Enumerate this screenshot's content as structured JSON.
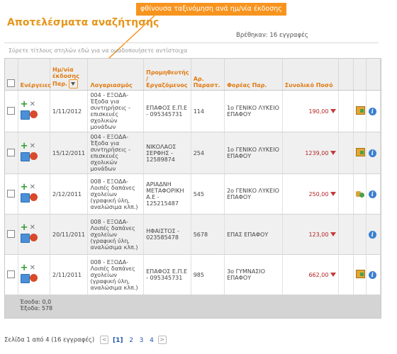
{
  "callout": "φθίνουσα ταξινόμηση ανά ημ/νία έκδοσης",
  "title": "Αποτελέσματα αναζήτησης",
  "found": "Βρέθηκαν: 16 εγγραφές",
  "drag_hint": "Σύρετε τίτλους στηλών εδώ για να ομαδοποιήσετε αντίστοιχα",
  "columns": {
    "actions": "Ενέργειες",
    "date": "Ημ/νία έκδοσης Παρ.",
    "account": "Λογαριασμός",
    "supplier": "Προμηθευτής / Εργαζόμενος",
    "docno": "Αρ. Παραστ.",
    "body": "Φορέας Παρ.",
    "total": "Συνολικό Ποσό"
  },
  "rows": [
    {
      "date": "1/11/2012",
      "account": "004 - ΕΞΟΔΑ-Έξοδα για συντηρήσεις - επισκευές σχολικών μονάδων",
      "supplier": "ΕΠΑΦΟΣ Ε.Π.Ε - 095345731",
      "docno": "114",
      "body": "1ο ΓΕΝΙΚΟ ΛΥΚΕΙΟ ΕΠΑΦΟΥ",
      "amount": "190,00",
      "extra": "folder-icon"
    },
    {
      "date": "15/12/2011",
      "account": "004 - ΕΞΟΔΑ-Έξοδα για συντηρήσεις - επισκευές σχολικών μονάδων",
      "supplier": "ΝΙΚΟΛΑΟΣ ΣΕΡΦΗΣ - 12589874",
      "docno": "254",
      "body": "1ο ΓΕΝΙΚΟ ΛΥΚΕΙΟ ΕΠΑΦΟΥ",
      "amount": "1239,00",
      "extra": "folder-icon"
    },
    {
      "date": "2/12/2011",
      "account": "008 - ΕΞΟΔΑ-Λοιπές δαπάνες σχολείων (γραφική ύλη, αναλώσιμα κλπ.)",
      "supplier": "ΑΡΙΑΔΝΗ ΜΕΤΑΦΟΡΙΚΗ Α.Ε - 125215487",
      "docno": "545",
      "body": "2ο ΓΕΝΙΚΟ ΛΥΚΕΙΟ ΕΠΑΦΟΥ",
      "amount": "250,00",
      "extra": "coins-icon"
    },
    {
      "date": "20/11/2011",
      "account": "008 - ΕΞΟΔΑ-Λοιπές δαπάνες σχολείων (γραφική ύλη, αναλώσιμα κλπ.)",
      "supplier": "ΗΦΑΙΣΤΟΣ - 023585478",
      "docno": "5678",
      "body": "ΕΠΑΣ ΕΠΑΦΟΥ",
      "amount": "123,00",
      "extra": ""
    },
    {
      "date": "2/11/2011",
      "account": "008 - ΕΞΟΔΑ-Λοιπές δαπάνες σχολείων (γραφική ύλη, αναλώσιμα κλπ.)",
      "supplier": "ΕΠΑΦΟΣ Ε.Π.Ε - 095345731",
      "docno": "985",
      "body": "3ο ΓΥΜΝΑΣΙΟ ΕΠΑΦΟΥ",
      "amount": "662,00",
      "extra": "folder-icon"
    }
  ],
  "footer": {
    "line1": "Έσοδα: 0,0",
    "line2": "Έξοδα: 578"
  },
  "pager": {
    "summary": "Σελίδα 1 από 4 (16 εγγραφές)",
    "prev": "<",
    "next": ">",
    "pages": [
      "[1]",
      "2",
      "3",
      "4"
    ]
  }
}
